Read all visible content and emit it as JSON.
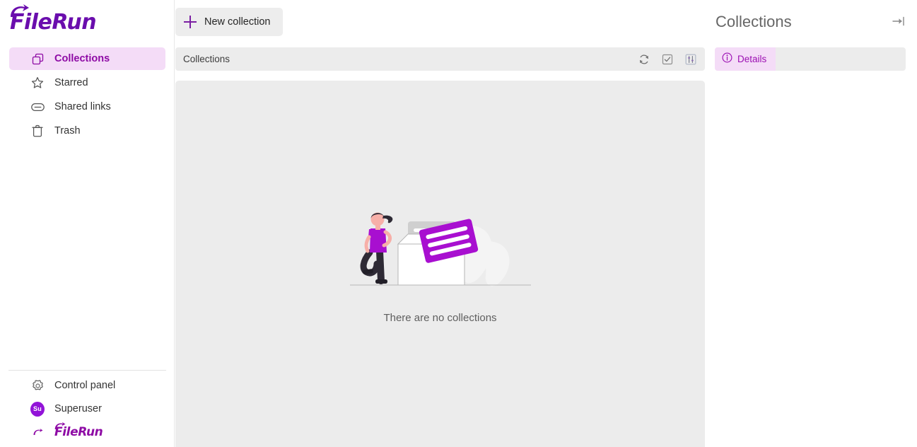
{
  "app": {
    "brand_name": "FileRun",
    "logo_color": "#6a0dad",
    "accent_color": "#8e0ba5",
    "accent_soft_bg": "#f4dcf7",
    "panel_bg": "#ececec"
  },
  "sidebar": {
    "items": [
      {
        "label": "Collections",
        "icon": "collections-icon",
        "active": true
      },
      {
        "label": "Starred",
        "icon": "star-icon",
        "active": false
      },
      {
        "label": "Shared links",
        "icon": "link-icon",
        "active": false
      },
      {
        "label": "Trash",
        "icon": "trash-icon",
        "active": false
      }
    ],
    "bottom_items": [
      {
        "label": "Control panel",
        "icon": "gear-icon"
      },
      {
        "label": "Superuser",
        "icon": "avatar",
        "avatar_initials": "Su",
        "avatar_color": "#9213d8"
      }
    ],
    "footer_brand": "FileRun"
  },
  "toolbar": {
    "new_collection_label": "New collection",
    "new_collection_icon": "plus-icon"
  },
  "content": {
    "breadcrumb": "Collections",
    "actions": [
      {
        "name": "refresh-icon",
        "title": "Refresh"
      },
      {
        "name": "select-checkbox-icon",
        "title": "Select"
      },
      {
        "name": "sort-options-icon",
        "title": "Sorting options"
      }
    ],
    "empty_state": {
      "message": "There are no collections",
      "illustration": "empty-collections-illustration"
    }
  },
  "right_panel": {
    "title": "Collections",
    "collapse_icon": "collapse-right-icon",
    "tabs": [
      {
        "label": "Details",
        "icon": "info-circle-icon",
        "active": true
      }
    ]
  }
}
